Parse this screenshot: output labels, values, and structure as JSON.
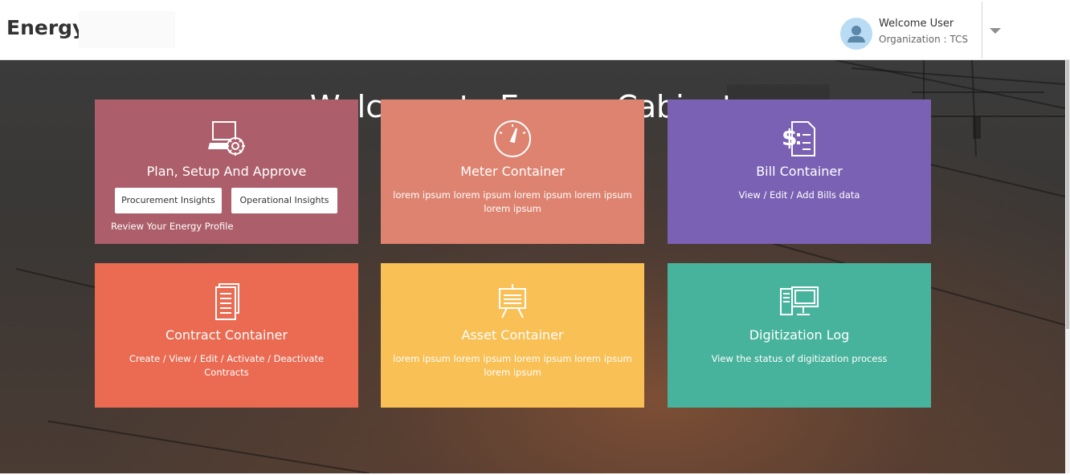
{
  "header": {
    "brand": "Energy",
    "user": {
      "welcome": "Welcome User",
      "organization": "Organization : TCS"
    }
  },
  "hero": {
    "title": "Welcome to Energy Cabinet"
  },
  "cards": [
    {
      "title": "Plan, Setup And Approve",
      "icon": "laptop-gear-icon",
      "color": "#ac5f6a",
      "buttons": [
        "Procurement Insights",
        "Operational Insights"
      ],
      "link": "Review Your Energy Profile"
    },
    {
      "title": "Meter Container",
      "icon": "gauge-icon",
      "color": "#de8370",
      "description": "lorem ipsum lorem ipsum lorem ipsum lorem ipsum lorem ipsum"
    },
    {
      "title": "Bill Container",
      "icon": "bill-document-icon",
      "color": "#7a61b3",
      "description": "View / Edit / Add Bills data"
    },
    {
      "title": "Contract Container",
      "icon": "documents-icon",
      "color": "#ea6a52",
      "description": "Create / View / Edit / Activate / Deactivate Contracts"
    },
    {
      "title": "Asset Container",
      "icon": "easel-board-icon",
      "color": "#f9c055",
      "description": "lorem ipsum lorem ipsum lorem ipsum lorem ipsum lorem ipsum"
    },
    {
      "title": "Digitization Log",
      "icon": "desktop-computer-icon",
      "color": "#48b39c",
      "description": "View the status of digitization process"
    }
  ]
}
